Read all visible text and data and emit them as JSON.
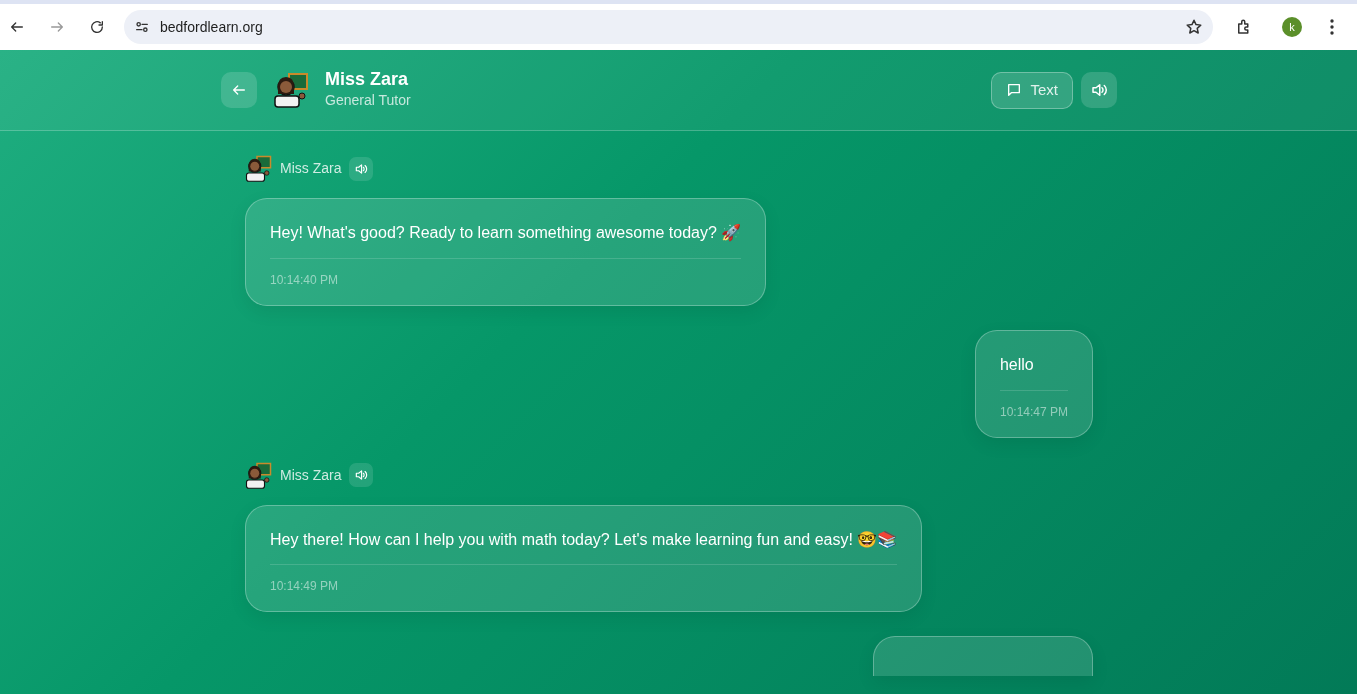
{
  "browser": {
    "url": "bedfordlearn.org",
    "profile_initial": "k"
  },
  "header": {
    "name": "Miss Zara",
    "role": "General Tutor",
    "mode_button": "Text"
  },
  "messages": [
    {
      "kind": "bot",
      "sender": "Miss Zara",
      "text": "Hey! What's good? Ready to learn something awesome today? 🚀",
      "time": "10:14:40 PM"
    },
    {
      "kind": "user",
      "text": "hello",
      "time": "10:14:47 PM"
    },
    {
      "kind": "bot",
      "sender": "Miss Zara",
      "text": "Hey there! How can I help you with math today? Let's make learning fun and easy! 🤓📚",
      "time": "10:14:49 PM"
    },
    {
      "kind": "user_partial"
    }
  ]
}
